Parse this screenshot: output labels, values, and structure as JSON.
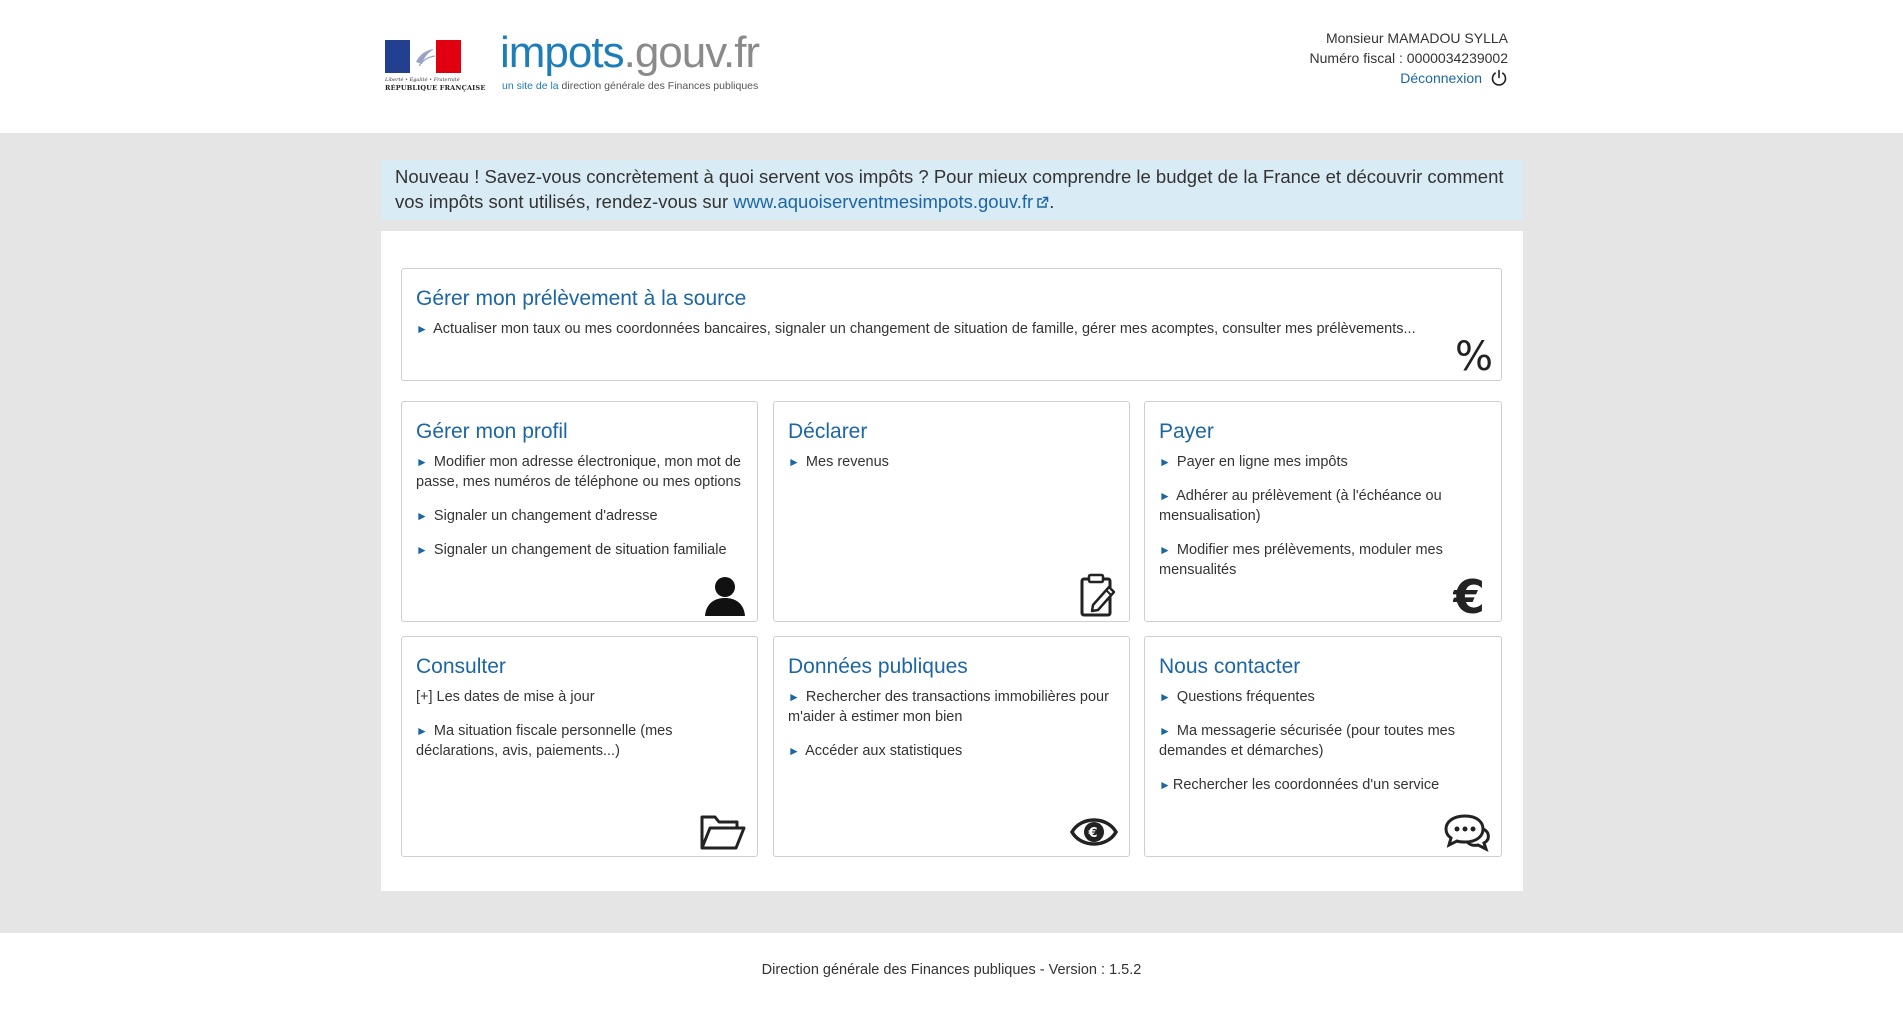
{
  "header": {
    "rf_motto": "Liberté • Égalité • Fraternité",
    "rf_name": "RÉPUBLIQUE FRANÇAISE",
    "brand_part1": "impots",
    "brand_part2": ".gouv.fr",
    "tagline_part1": "un site de la",
    "tagline_part2": "direction générale des Finances publiques",
    "user_name": "Monsieur MAMADOU SYLLA",
    "fiscal_number": "Numéro fiscal : 0000034239002",
    "logout_label": "Déconnexion"
  },
  "info": {
    "text": "Nouveau ! Savez-vous concrètement à quoi servent vos impôts ? Pour mieux comprendre le budget de la France et découvrir comment vos impôts sont utilisés, rendez-vous sur ",
    "link": "www.aquoiserventmesimpots.gouv.fr",
    "after": "."
  },
  "cards": {
    "prelevement": {
      "title": "Gérer mon prélèvement à la source",
      "item1": "Actualiser mon taux ou mes coordonnées bancaires, signaler un changement de situation de famille, gérer mes acomptes, consulter mes prélèvements..."
    },
    "profil": {
      "title": "Gérer mon profil",
      "item1": "Modifier mon adresse électronique, mon mot de passe, mes numéros de téléphone ou mes options",
      "item2": "Signaler un changement d'adresse",
      "item3": "Signaler un changement de situation familiale"
    },
    "declarer": {
      "title": "Déclarer",
      "item1": "Mes revenus"
    },
    "payer": {
      "title": "Payer",
      "item1": "Payer en ligne mes impôts",
      "item2": "Adhérer au prélèvement (à l'échéance ou mensualisation)",
      "item3": "Modifier mes prélèvements, moduler mes mensualités"
    },
    "consulter": {
      "title": "Consulter",
      "item1": "[+] Les dates de mise à jour",
      "item2": "Ma situation fiscale personnelle (mes déclarations, avis, paiements...)"
    },
    "donnees": {
      "title": "Données publiques",
      "item1": "Rechercher des transactions immobilières pour m'aider à estimer mon bien",
      "item2": "Accéder aux statistiques"
    },
    "contact": {
      "title": "Nous contacter",
      "item1": "Questions fréquentes",
      "item2": "Ma messagerie sécurisée (pour toutes mes demandes et démarches)",
      "item3": "Rechercher les coordonnées d'un service"
    }
  },
  "footer": {
    "text": "Direction générale des Finances publiques - Version : 1.5.2"
  },
  "colors": {
    "link_blue": "#1d66a4",
    "brand_blue": "#1d7db9",
    "info_bg": "#d9ebf5",
    "page_bg": "#e5e5e5"
  },
  "icons": {
    "prelevement": "percent-icon",
    "profil": "user-icon",
    "declarer": "clipboard-pen-icon",
    "payer": "euro-icon",
    "consulter": "folder-icon",
    "donnees": "eye-euro-icon",
    "contact": "chat-bubbles-icon",
    "logout": "power-icon",
    "external": "external-link-icon"
  }
}
